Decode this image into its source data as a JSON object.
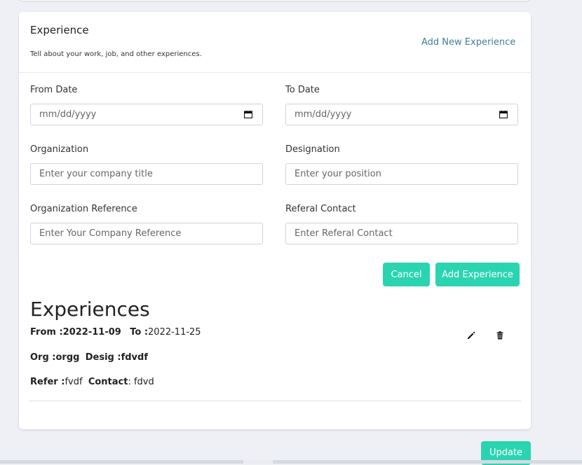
{
  "header": {
    "title": "Experience",
    "subtitle": "Tell about your work, job, and other experiences.",
    "add_link": "Add New Experience"
  },
  "form": {
    "from_date": {
      "label": "From Date",
      "placeholder": "mm/dd/yyyy"
    },
    "to_date": {
      "label": "To Date",
      "placeholder": "mm/dd/yyyy"
    },
    "organization": {
      "label": "Organization",
      "placeholder": "Enter your company title"
    },
    "designation": {
      "label": "Designation",
      "placeholder": "Enter your position"
    },
    "org_reference": {
      "label": "Organization Reference",
      "placeholder": "Enter Your Company Reference"
    },
    "referral_contact": {
      "label": "Referal Contact",
      "placeholder": "Enter Referal Contact"
    },
    "cancel_label": "Cancel",
    "add_label": "Add Experience"
  },
  "experiences": {
    "heading": "Experiences",
    "items": [
      {
        "from_label": "From :",
        "from": "2022-11-09",
        "to_label": "To :",
        "to": "2022-11-25",
        "org_label": "Org :",
        "org": "orgg",
        "desig_label": "Desig :",
        "desig": "fdvdf",
        "refer_label": "Refer :",
        "refer": "fvdf",
        "contact_label": "Contact",
        "contact": ": fdvd"
      }
    ],
    "edit_icon": "pencil-icon",
    "delete_icon": "trash-icon"
  },
  "footer": {
    "update_label": "Update"
  },
  "colors": {
    "accent": "#2bd4b0",
    "link": "#3f7e98",
    "background": "#eef0f5"
  }
}
